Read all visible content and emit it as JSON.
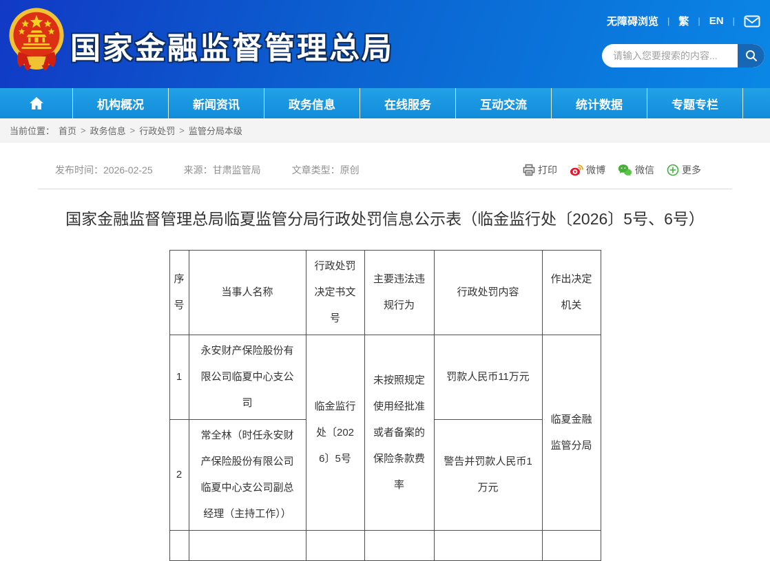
{
  "topbar": {
    "accessibility": "无障碍浏览",
    "traditional": "繁",
    "english": "EN"
  },
  "header": {
    "site_title": "国家金融监督管理总局",
    "search_placeholder": "请输入您要搜索的内容..."
  },
  "nav": {
    "items": [
      "机构概况",
      "新闻资讯",
      "政务信息",
      "在线服务",
      "互动交流",
      "统计数据",
      "专题专栏"
    ]
  },
  "breadcrumb": {
    "label": "当前位置：",
    "separator": ">",
    "items": [
      "首页",
      "政务信息",
      "行政处罚",
      "监管分局本级"
    ]
  },
  "article": {
    "meta": {
      "publish_label": "发布时间：",
      "publish_date": "2026-02-25",
      "source_label": "来源：",
      "source": "甘肃监管局",
      "type_label": "文章类型：",
      "type": "原创"
    },
    "share": {
      "print": "打印",
      "weibo": "微博",
      "wechat": "微信",
      "more": "更多"
    },
    "title": "国家金融监督管理总局临夏监管分局行政处罚信息公示表（临金监行处〔2026〕5号、6号）"
  },
  "table": {
    "headers": [
      "序号",
      "当事人名称",
      "行政处罚决定书文号",
      "主要违法违规行为",
      "行政处罚内容",
      "作出决定机关"
    ],
    "doc_no": "临金监行处〔2026〕5号",
    "violation": "未按照规定使用经批准或者备案的保险条款费率",
    "authority": "临夏金融监管分局",
    "rows": [
      {
        "no": "1",
        "party": "永安财产保险股份有限公司临夏中心支公司",
        "penalty": "罚款人民币11万元"
      },
      {
        "no": "2",
        "party": "常全林（时任永安财产保险股份有限公司临夏中心支公司副总经理（主持工作））",
        "penalty": "警告并罚款人民币1万元"
      }
    ]
  },
  "colors": {
    "header_gradient_start": "#1139c5",
    "header_gradient_end": "#0a87e6",
    "nav_blue": "#1b9ae3",
    "search_button_blue": "#1767b4",
    "weibo_red": "#e6162d",
    "wechat_green": "#45b035",
    "more_green": "#3db03a",
    "table_border": "#4d4d4d"
  }
}
